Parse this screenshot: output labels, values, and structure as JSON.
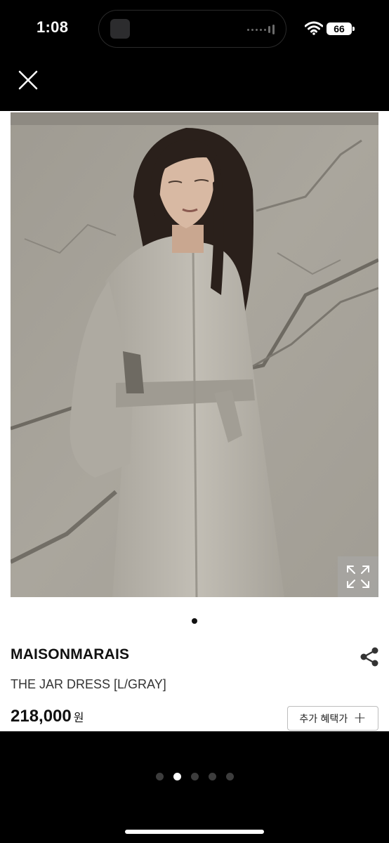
{
  "status_bar": {
    "time": "1:08",
    "battery": "66"
  },
  "product": {
    "brand": "MAISONMARAIS",
    "name": "THE JAR DRESS [L/GRAY]",
    "price": "218,000",
    "currency": "원",
    "benefit_button_label": "추가 혜택가"
  },
  "photo_viewer": {
    "image_count": 1,
    "image_index": 1
  },
  "gallery": {
    "page_count": 5,
    "active_page": 2
  },
  "colors": {
    "background": "#000000",
    "card": "#ffffff",
    "text": "#111111",
    "dress": "#b8b4ac"
  }
}
